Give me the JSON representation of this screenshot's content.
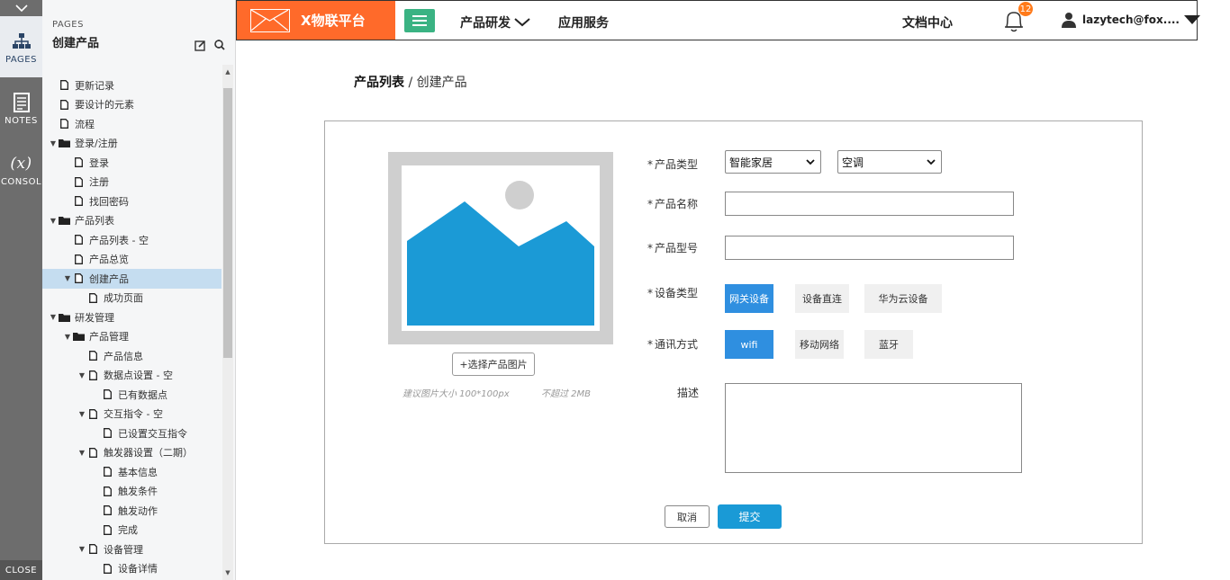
{
  "rail": {
    "pages_label": "PAGES",
    "notes_label": "NOTES",
    "console_label": "CONSOL",
    "console_glyph": "(x)",
    "close_label": "CLOSE"
  },
  "pages_panel": {
    "caption": "PAGES",
    "title": "创建产品",
    "tree": [
      {
        "label": "更新记录",
        "type": "page",
        "depth": 1
      },
      {
        "label": "要设计的元素",
        "type": "page",
        "depth": 1
      },
      {
        "label": "流程",
        "type": "page",
        "depth": 1
      },
      {
        "label": "登录/注册",
        "type": "folder",
        "depth": 0
      },
      {
        "label": "登录",
        "type": "page",
        "depth": 2
      },
      {
        "label": "注册",
        "type": "page",
        "depth": 2
      },
      {
        "label": "找回密码",
        "type": "page",
        "depth": 2
      },
      {
        "label": "产品列表",
        "type": "folder",
        "depth": 0
      },
      {
        "label": "产品列表 - 空",
        "type": "page",
        "depth": 2
      },
      {
        "label": "产品总览",
        "type": "page",
        "depth": 2
      },
      {
        "label": "创建产品",
        "type": "page-expand",
        "depth": 1,
        "selected": true
      },
      {
        "label": "成功页面",
        "type": "page",
        "depth": 3
      },
      {
        "label": "研发管理",
        "type": "folder",
        "depth": 0
      },
      {
        "label": "产品管理",
        "type": "folder-sub",
        "depth": 1
      },
      {
        "label": "产品信息",
        "type": "page",
        "depth": 3
      },
      {
        "label": "数据点设置 - 空",
        "type": "page-expand",
        "depth": 2
      },
      {
        "label": "已有数据点",
        "type": "page",
        "depth": 4
      },
      {
        "label": "交互指令 - 空",
        "type": "page-expand",
        "depth": 2
      },
      {
        "label": "已设置交互指令",
        "type": "page",
        "depth": 4
      },
      {
        "label": "触发器设置（二期）",
        "type": "page-expand",
        "depth": 2
      },
      {
        "label": "基本信息",
        "type": "page",
        "depth": 4
      },
      {
        "label": "触发条件",
        "type": "page",
        "depth": 4
      },
      {
        "label": "触发动作",
        "type": "page",
        "depth": 4
      },
      {
        "label": "完成",
        "type": "page",
        "depth": 4
      },
      {
        "label": "设备管理",
        "type": "page-expand",
        "depth": 2
      },
      {
        "label": "设备详情",
        "type": "page",
        "depth": 4
      }
    ]
  },
  "topbar": {
    "brand": "X物联平台",
    "nav_product_dev": "产品研发",
    "nav_app_service": "应用服务",
    "docs": "文档中心",
    "notification_count": "12",
    "user": "lazytech@fox...."
  },
  "breadcrumb": {
    "parent": "产品列表",
    "separator": " / ",
    "current": "创建产品"
  },
  "form": {
    "image_button": "+选择产品图片",
    "hint_size": "建议图片大小 100*100px",
    "hint_limit": "不超过 2MB",
    "required_mark": "*",
    "product_type_label": "产品类型",
    "product_type_value": "智能家居",
    "product_subtype_value": "空调",
    "product_name_label": "产品名称",
    "product_name_value": "",
    "product_model_label": "产品型号",
    "product_model_value": "",
    "device_type_label": "设备类型",
    "device_types": [
      {
        "label": "网关设备",
        "selected": true
      },
      {
        "label": "设备直连",
        "selected": false
      },
      {
        "label": "华为云设备",
        "selected": false
      }
    ],
    "comm_label": "通讯方式",
    "comm_methods": [
      {
        "label": "wifi",
        "selected": true
      },
      {
        "label": "移动网络",
        "selected": false
      },
      {
        "label": "蓝牙",
        "selected": false
      }
    ],
    "desc_label": "描述",
    "desc_value": "",
    "cancel": "取消",
    "submit": "提交"
  },
  "colors": {
    "brand": "#ff6a2a",
    "menu_button": "#3ab383",
    "option_selected": "#2f8fe0",
    "submit": "#1a9ad6",
    "placeholder_image": "#1b9ad6"
  }
}
